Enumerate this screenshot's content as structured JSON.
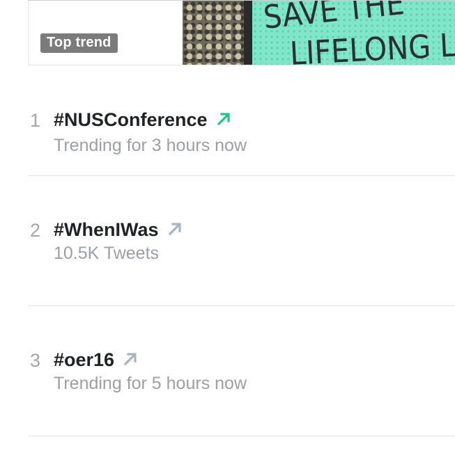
{
  "top_card": {
    "badge_label": "Top trend",
    "sign_text_line1": "SAVE THE",
    "sign_text_line2": "LIFELONG LE"
  },
  "colors": {
    "arrow_up_green": "#22c38e",
    "arrow_up_gray": "#a9b3bd",
    "text_primary": "#1f2326",
    "text_secondary": "#9aa0a6"
  },
  "trends": [
    {
      "rank": "1",
      "hashtag": "#NUSConference",
      "meta": "Trending for 3 hours now",
      "arrow_icon": "arrow-up-right-icon",
      "arrow_color": "#22c38e"
    },
    {
      "rank": "2",
      "hashtag": "#WhenIWas",
      "meta": "10.5K Tweets",
      "arrow_icon": "arrow-up-right-icon",
      "arrow_color": "#a9b3bd"
    },
    {
      "rank": "3",
      "hashtag": "#oer16",
      "meta": "Trending for 5 hours now",
      "arrow_icon": "arrow-up-right-icon",
      "arrow_color": "#a9b3bd"
    }
  ]
}
